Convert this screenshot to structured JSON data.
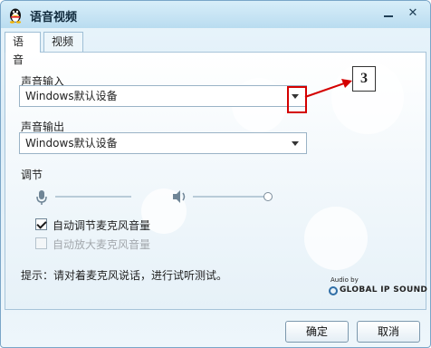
{
  "window": {
    "title": "语音视频"
  },
  "tabs": [
    {
      "label": "语音"
    },
    {
      "label": "视频"
    }
  ],
  "input": {
    "label": "声音输入",
    "selected": "Windows默认设备"
  },
  "output": {
    "label": "声音输出",
    "selected": "Windows默认设备"
  },
  "callout": {
    "number": "3"
  },
  "adjust": {
    "label": "调节",
    "mic_level": 0.0,
    "speaker_level": 1.0
  },
  "checks": {
    "auto_adjust": {
      "label": "自动调节麦克风音量",
      "checked": true
    },
    "auto_amplify": {
      "label": "自动放大麦克风音量",
      "checked": false,
      "disabled": true
    }
  },
  "hint": "提示：请对着麦克风说话，进行试听测试。",
  "brand": {
    "small": "Audio by",
    "big": "GLOBAL IP SOUND"
  },
  "buttons": {
    "ok": "确定",
    "cancel": "取消"
  },
  "colors": {
    "accent_red": "#d40000",
    "frame_blue": "#7aa6c8"
  },
  "icons": [
    "qq-penguin-icon",
    "minimize-icon",
    "close-icon",
    "microphone-icon",
    "speaker-icon",
    "chevron-down-icon"
  ]
}
